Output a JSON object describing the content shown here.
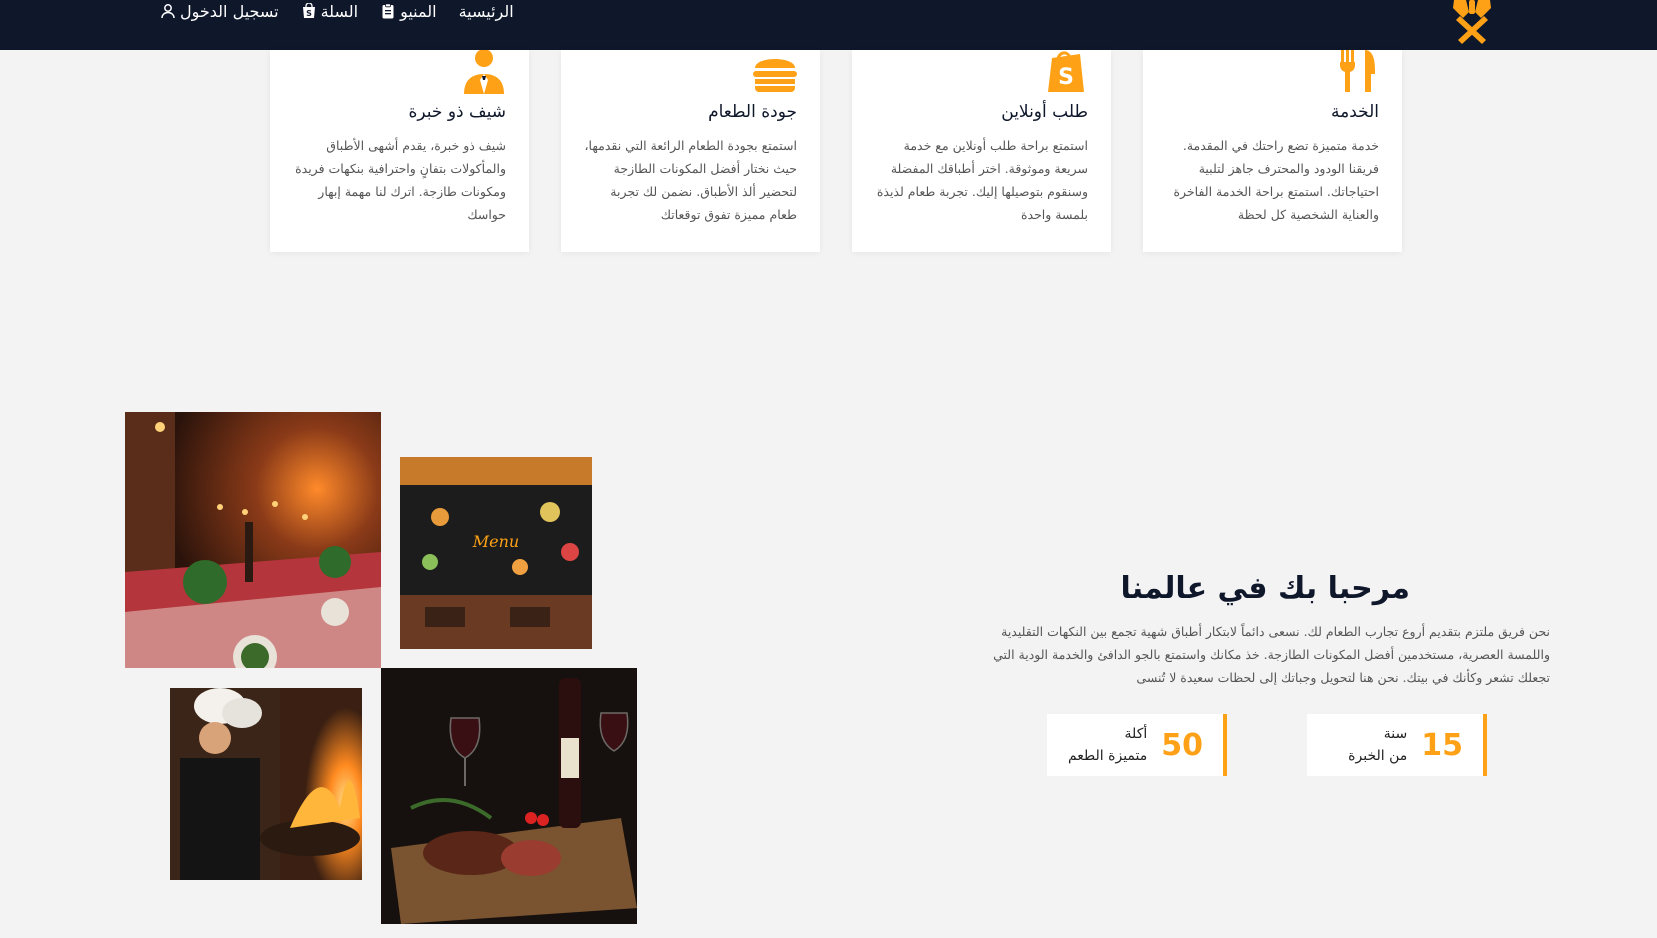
{
  "nav": {
    "home": "الرئيسية",
    "menu": "المنيو",
    "cart": "السلة",
    "login": "تسجيل الدخول"
  },
  "services": [
    {
      "icon": "utensils-icon",
      "title": "الخدمة",
      "text": "خدمة متميزة تضع راحتك في المقدمة. فريقنا الودود والمحترف جاهز لتلبية احتياجاتك. استمتع براحة الخدمة الفاخرة والعناية الشخصية كل لحظة"
    },
    {
      "icon": "shopify-bag-icon",
      "title": "طلب أونلاين",
      "text": "استمتع براحة طلب أونلاين مع خدمة سريعة وموثوقة. اختر أطباقك المفضلة وسنقوم بتوصيلها إليك. تجربة طعام لذيذة بلمسة واحدة"
    },
    {
      "icon": "burger-icon",
      "title": "جودة الطعام",
      "text": "استمتع بجودة الطعام الرائعة التي نقدمها، حيث نختار أفضل المكونات الطازجة لتحضير ألذ الأطباق. نضمن لك تجربة طعام مميزة تفوق توقعاتك"
    },
    {
      "icon": "chef-user-icon",
      "title": "شيف ذو خبرة",
      "text": "شيف ذو خبرة، يقدم أشهى الأطباق والمأكولات بتفانٍ واحترافية بنكهات فريدة ومكونات طازجة. اترك لنا مهمة إبهار حواسك"
    }
  ],
  "about": {
    "title": "مرحبا بك في عالمنا",
    "text": "نحن فريق ملتزم بتقديم أروع تجارب الطعام لك. نسعى دائماً لابتكار أطباق شهية تجمع بين النكهات التقليدية واللمسة العصرية، مستخدمين أفضل المكونات الطازجة. خذ مكانك واستمتع بالجو الدافئ والخدمة الودية التي تجعلك تشعر وكأنك في بيتك. نحن هنا لتحويل وجباتك إلى لحظات سعيدة لا تُنسى",
    "stats": [
      {
        "number": "15",
        "label_top": "سنة",
        "label_bottom": "من الخبرة"
      },
      {
        "number": "50",
        "label_top": "أكلة",
        "label_bottom": "متميزة الطعم"
      }
    ]
  },
  "photos": [
    {
      "name": "restaurant-interior-photo"
    },
    {
      "name": "menu-wall-photo"
    },
    {
      "name": "chefs-cooking-photo"
    },
    {
      "name": "steak-wine-photo"
    }
  ],
  "colors": {
    "accent": "#fea116",
    "dark": "#0f172b",
    "background": "#f3f3f3"
  }
}
